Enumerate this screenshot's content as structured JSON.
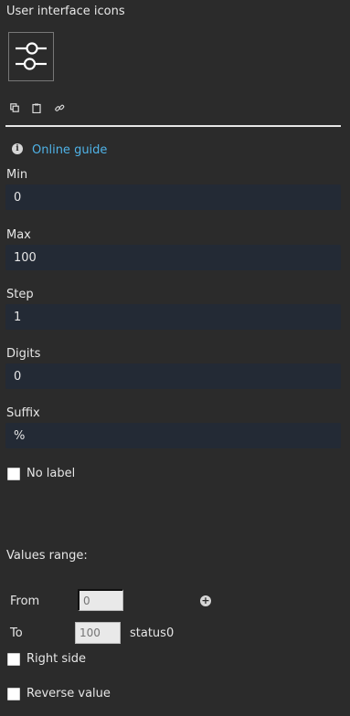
{
  "header": {
    "title": "User interface icons"
  },
  "toolbar": {
    "icons": [
      "copy-icon",
      "clipboard-icon",
      "link-icon"
    ]
  },
  "guide": {
    "label": "Online guide"
  },
  "fields": {
    "min": {
      "label": "Min",
      "value": "0"
    },
    "max": {
      "label": "Max",
      "value": "100"
    },
    "step": {
      "label": "Step",
      "value": "1"
    },
    "digits": {
      "label": "Digits",
      "value": "0"
    },
    "suffix": {
      "label": "Suffix",
      "value": "%"
    }
  },
  "no_label": {
    "label": "No label",
    "checked": false
  },
  "values_range": {
    "title": "Values range:",
    "from_label": "From",
    "from_placeholder": "0",
    "to_label": "To",
    "to_placeholder": "100",
    "status": "status0"
  },
  "right_side": {
    "label": "Right side",
    "checked": false
  },
  "reverse_value": {
    "label": "Reverse value",
    "checked": false
  },
  "colors": {
    "background": "#2b2b2b",
    "input_background": "#232a35",
    "link": "#4fb3e8"
  }
}
